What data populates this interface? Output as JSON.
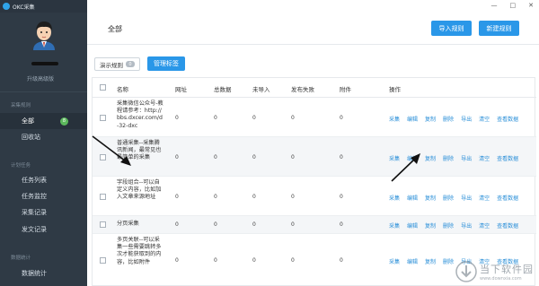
{
  "app": {
    "title": "OKC采集"
  },
  "window_controls": {
    "minimize": "—",
    "maximize": "□",
    "close": "✕"
  },
  "sidebar": {
    "upgrade": "升级高级版",
    "section_collect": "采集规则",
    "items_collect": [
      {
        "label": "全部",
        "badge": "8",
        "active": true
      },
      {
        "label": "回收站"
      }
    ],
    "section_tasks": "计划任务",
    "items_tasks": [
      {
        "label": "任务列表"
      },
      {
        "label": "任务监控"
      },
      {
        "label": "采集记录"
      },
      {
        "label": "发文记录"
      }
    ],
    "section_stats": "数据统计",
    "items_stats": [
      {
        "label": "数据统计"
      }
    ]
  },
  "header": {
    "title": "全部",
    "import_button": "导入规则",
    "new_button": "新建规则"
  },
  "toolbar": {
    "demo_rules": "演示规则",
    "demo_count": "0",
    "manage_tags": "管理标签"
  },
  "table": {
    "columns": [
      "名称",
      "网址",
      "总数据",
      "未导入",
      "发布失败",
      "附件",
      "操作"
    ],
    "ops": [
      "采集",
      "编辑",
      "复制",
      "删除",
      "导出",
      "清空",
      "查看数据"
    ],
    "rows": [
      {
        "name": "采集微信公众号-教程请参考：http://bbs.dxcer.com/d-32-dxc",
        "url": "0",
        "total": "0",
        "unimported": "0",
        "failed": "0",
        "attach": "0"
      },
      {
        "name": "普通采集--采集腾讯新闻，最常见也最简单的采集",
        "url": "0",
        "total": "0",
        "unimported": "0",
        "failed": "0",
        "attach": "0"
      },
      {
        "name": "字段组合--可以自定义内容，比如加入文章来源地址",
        "url": "0",
        "total": "0",
        "unimported": "0",
        "failed": "0",
        "attach": "0"
      },
      {
        "name": "分页采集",
        "url": "0",
        "total": "0",
        "unimported": "0",
        "failed": "0",
        "attach": "0"
      },
      {
        "name": "多页关联--可以采集一些需要跳转多次才能获取到的内容，比如附件",
        "url": "0",
        "total": "0",
        "unimported": "0",
        "failed": "0",
        "attach": "0"
      }
    ]
  },
  "watermark": {
    "text": "当下软件园",
    "url": "www.downxia.com"
  },
  "colors": {
    "sidebar": "#2f3a45",
    "accent": "#2a97e8",
    "badge": "#5cb85c",
    "link": "#2a8fd8"
  }
}
